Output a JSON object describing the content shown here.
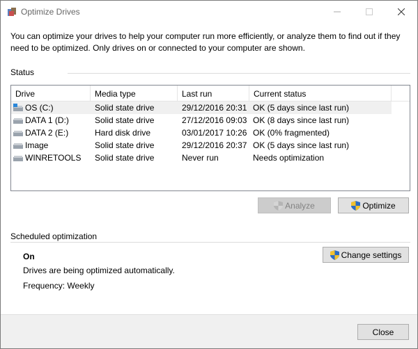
{
  "window": {
    "title": "Optimize Drives"
  },
  "intro": "You can optimize your drives to help your computer run more efficiently, or analyze them to find out if they need to be optimized. Only drives on or connected to your computer are shown.",
  "status": {
    "label": "Status",
    "columns": [
      "Drive",
      "Media type",
      "Last run",
      "Current status"
    ],
    "drives": [
      {
        "name": "OS (C:)",
        "media": "Solid state drive",
        "last_run": "29/12/2016 20:31",
        "status": "OK (5 days since last run)",
        "icon": "os-drive-icon",
        "selected": true
      },
      {
        "name": "DATA 1 (D:)",
        "media": "Solid state drive",
        "last_run": "27/12/2016 09:03",
        "status": "OK (8 days since last run)",
        "icon": "drive-icon",
        "selected": false
      },
      {
        "name": "DATA 2 (E:)",
        "media": "Hard disk drive",
        "last_run": "03/01/2017 10:26",
        "status": "OK (0% fragmented)",
        "icon": "drive-icon",
        "selected": false
      },
      {
        "name": "Image",
        "media": "Solid state drive",
        "last_run": "29/12/2016 20:37",
        "status": "OK (5 days since last run)",
        "icon": "drive-icon",
        "selected": false
      },
      {
        "name": "WINRETOOLS",
        "media": "Solid state drive",
        "last_run": "Never run",
        "status": "Needs optimization",
        "icon": "drive-icon",
        "selected": false
      }
    ],
    "analyze_label": "Analyze",
    "optimize_label": "Optimize"
  },
  "scheduled": {
    "label": "Scheduled optimization",
    "state": "On",
    "description": "Drives are being optimized automatically.",
    "frequency": "Frequency: Weekly",
    "change_label": "Change settings"
  },
  "close_label": "Close",
  "colors": {
    "selected_row": "#f0f0f0",
    "border": "#828790"
  }
}
